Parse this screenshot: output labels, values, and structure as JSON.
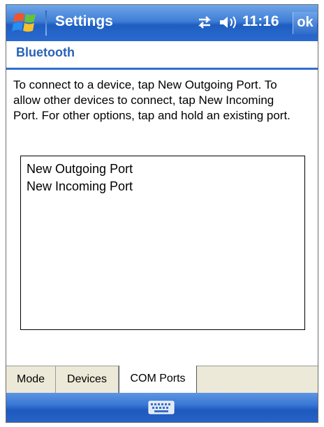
{
  "titlebar": {
    "title": "Settings",
    "time": "11:16",
    "ok_label": "ok",
    "icons": [
      "windows-start-icon",
      "connectivity-icon",
      "volume-icon"
    ]
  },
  "page": {
    "heading": "Bluetooth",
    "instructions": "To connect to a device, tap New Outgoing Port. To allow other devices to connect, tap New Incoming Port. For other options, tap and hold an existing port."
  },
  "ports": {
    "items": [
      "New Outgoing Port",
      "New Incoming Port"
    ]
  },
  "tabs": {
    "items": [
      "Mode",
      "Devices",
      "COM Ports"
    ],
    "selected": "COM Ports"
  },
  "menubar": {
    "icons": [
      "keyboard-icon"
    ]
  },
  "colors": {
    "titlebar_blue": "#2a6ad0",
    "heading_blue": "#2961b8",
    "rule_blue": "#2f6fd0",
    "tab_strip": "#ece9d8"
  }
}
